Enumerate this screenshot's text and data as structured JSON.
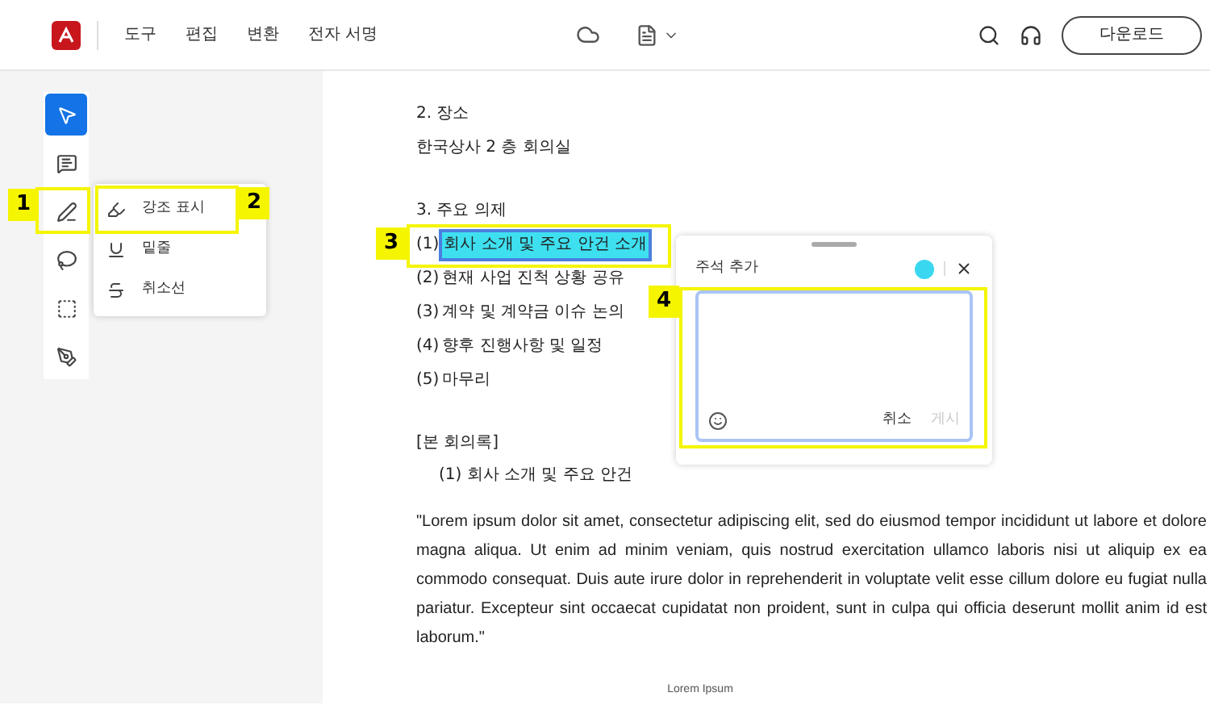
{
  "header": {
    "nav": [
      "도구",
      "편집",
      "변환",
      "전자 서명"
    ],
    "download": "다운로드"
  },
  "tools": [
    {
      "kind": "select",
      "selected": true
    },
    {
      "kind": "comment",
      "selected": false
    },
    {
      "kind": "pen",
      "selected": false
    },
    {
      "kind": "lasso",
      "selected": false
    },
    {
      "kind": "textbox",
      "selected": false
    },
    {
      "kind": "sign",
      "selected": false
    }
  ],
  "flyout": {
    "items": [
      {
        "kind": "highlight",
        "label": "강조 표시"
      },
      {
        "kind": "underline",
        "label": "밑줄"
      },
      {
        "kind": "strikethrough",
        "label": "취소선"
      }
    ]
  },
  "document": {
    "blocks": [
      {
        "kind": "line",
        "text": "2. 장소"
      },
      {
        "kind": "line",
        "text": "한국상사 2 층 회의실"
      },
      {
        "kind": "gap"
      },
      {
        "kind": "line",
        "text": "3. 주요 의제"
      },
      {
        "kind": "item",
        "number": "(1)",
        "text": "회사 소개 및 주요 안건 소개",
        "highlighted": true
      },
      {
        "kind": "item",
        "number": "(2)",
        "text": "현재 사업 진척 상황 공유",
        "highlighted": false
      },
      {
        "kind": "item",
        "number": "(3)",
        "text": "계약 및 계약금 이슈 논의",
        "highlighted": false
      },
      {
        "kind": "item",
        "number": "(4)",
        "text": "향후 진행사항 및 일정",
        "highlighted": false
      },
      {
        "kind": "item",
        "number": "(5)",
        "text": "마무리",
        "highlighted": false
      },
      {
        "kind": "gap"
      },
      {
        "kind": "line",
        "text": "[본 회의록]"
      },
      {
        "kind": "subline",
        "text": "(1)  회사 소개 및 주요 안건"
      },
      {
        "kind": "paragraph",
        "text": "\"Lorem ipsum dolor sit amet, consectetur adipiscing elit, sed do eiusmod tempor incididunt ut labore et dolore magna aliqua. Ut enim ad minim veniam, quis nostrud exercitation ullamco laboris nisi ut aliquip ex ea commodo consequat. Duis aute irure dolor in reprehenderit in voluptate velit esse cillum dolore eu fugiat nulla pariatur. Excepteur sint occaecat cupidatat non proident, sunt in culpa qui officia deserunt mollit anim id est laborum.\""
      },
      {
        "kind": "caption",
        "text": "Lorem Ipsum"
      }
    ]
  },
  "comment": {
    "title": "주석 추가",
    "color": "#3ad7f0",
    "cancel": "취소",
    "post": "게시",
    "post_disabled": true
  },
  "callouts": [
    "1",
    "2",
    "3",
    "4"
  ]
}
